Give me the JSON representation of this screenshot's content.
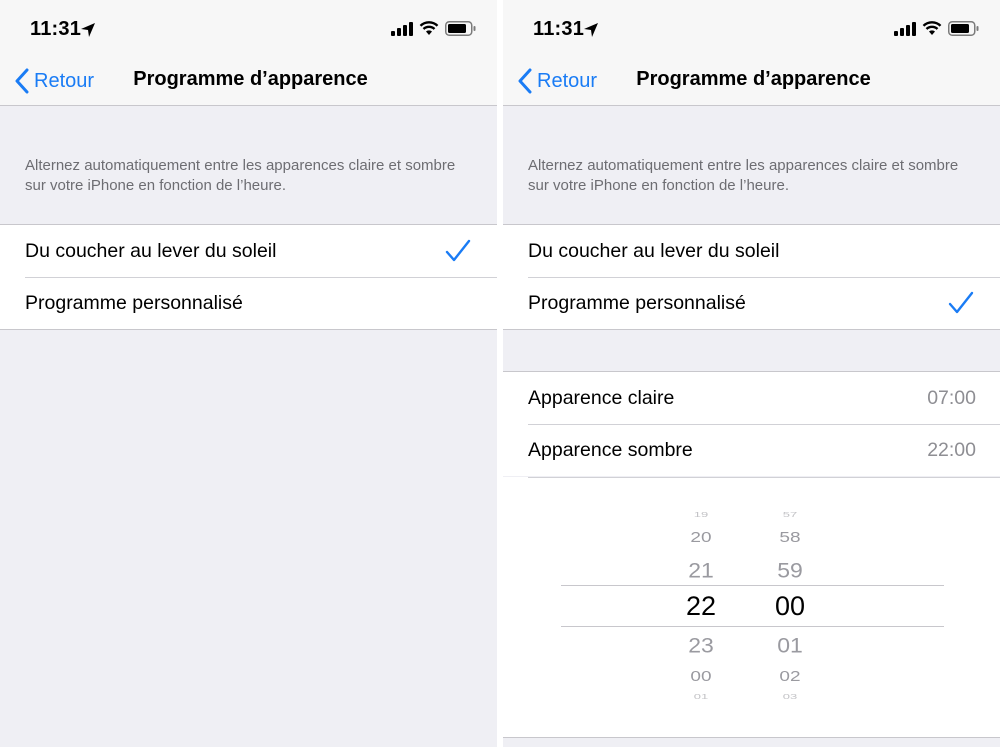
{
  "status": {
    "time": "11:31"
  },
  "nav": {
    "back_label": "Retour",
    "title": "Programme d’apparence"
  },
  "description": "Alternez automatiquement entre les apparences claire et sombre sur votre iPhone en fonction de l’heure.",
  "options": {
    "sunset": "Du coucher au lever du soleil",
    "custom": "Programme personnalisé"
  },
  "left_screen": {
    "selected_option": "Du coucher au lever du soleil"
  },
  "right_screen": {
    "selected_option": "Programme personnalisé",
    "light_label": "Apparence claire",
    "light_time": "07:00",
    "dark_label": "Apparence sombre",
    "dark_time": "22:00"
  },
  "picker": {
    "hours": [
      "19",
      "20",
      "21",
      "22",
      "23",
      "00",
      "01"
    ],
    "minutes": [
      "57",
      "58",
      "59",
      "00",
      "01",
      "02",
      "03"
    ],
    "selected_hour": "22",
    "selected_minute": "00"
  },
  "colors": {
    "accent": "#1a7cf5",
    "background": "#efeff4",
    "secondary_text": "#8e8e93"
  }
}
